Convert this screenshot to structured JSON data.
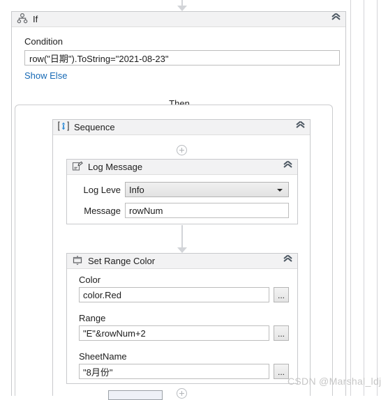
{
  "canvas": {
    "background": "#ffffff",
    "gridline_color": "#d4d4d8",
    "gridlines_x": [
      502,
      521,
      540
    ]
  },
  "if_activity": {
    "title": "If",
    "icon": "if-branch-icon",
    "collapse_icon": "double-chevron-up-icon",
    "condition_label": "Condition",
    "condition_value": "row(\"日期\").ToString=\"2021-08-23\"",
    "show_else_link": "Show Else",
    "then_label": "Then"
  },
  "sequence_activity": {
    "title": "Sequence",
    "icon": "sequence-icon",
    "collapse_icon": "double-chevron-up-icon",
    "add_icon": "plus-circle-icon"
  },
  "log_message_activity": {
    "title": "Log Message",
    "icon": "log-message-icon",
    "collapse_icon": "double-chevron-up-icon",
    "fields": [
      {
        "label": "Log Leve",
        "type": "combobox",
        "value": "Info",
        "caret_icon": "chevron-down-icon"
      },
      {
        "label": "Message",
        "type": "textbox",
        "value": "rowNum"
      }
    ]
  },
  "set_range_color_activity": {
    "title": "Set Range Color",
    "icon": "set-range-color-icon",
    "collapse_icon": "double-chevron-up-icon",
    "fields": [
      {
        "label": "Color",
        "value": "color.Red",
        "browse_label": "..."
      },
      {
        "label": "Range",
        "value": "\"E\"&rowNum+2",
        "browse_label": "..."
      },
      {
        "label": "SheetName",
        "value": "\"8月份\"",
        "browse_label": "..."
      }
    ]
  },
  "watermark": {
    "text": "CSDN @Marshal_ldj",
    "color": "#c6c6c6"
  },
  "colors": {
    "header_bar": "#f2f2f3",
    "card_border": "#c8c9cc",
    "link_blue": "#1669b5",
    "connector_gray": "#d2d4d8",
    "sequence_icon_blue": "#2e8bd6"
  }
}
